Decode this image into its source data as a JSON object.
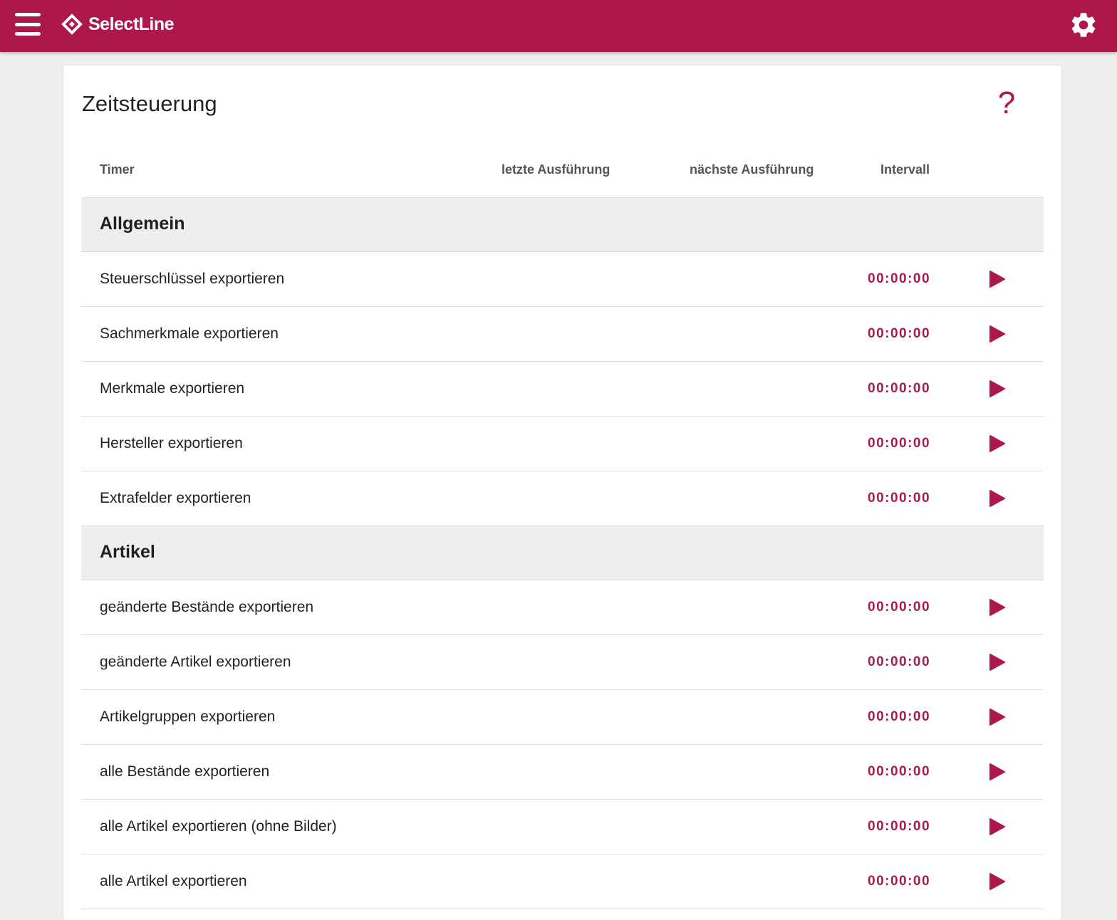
{
  "app": {
    "brand": "SelectLine",
    "accent_color": "#ac1848"
  },
  "header": {
    "menu_icon": "hamburger-menu-icon",
    "settings_icon": "gear-icon"
  },
  "page": {
    "title": "Zeitsteuerung",
    "help_label": "?"
  },
  "table": {
    "columns": {
      "timer": "Timer",
      "last_run": "letzte Ausführung",
      "next_run": "nächste Ausführung",
      "interval": "Intervall"
    },
    "sections": [
      {
        "title": "Allgemein",
        "rows": [
          {
            "name": "Steuerschlüssel exportieren",
            "last_run": "",
            "next_run": "",
            "interval": "00:00:00"
          },
          {
            "name": "Sachmerkmale exportieren",
            "last_run": "",
            "next_run": "",
            "interval": "00:00:00"
          },
          {
            "name": "Merkmale exportieren",
            "last_run": "",
            "next_run": "",
            "interval": "00:00:00"
          },
          {
            "name": "Hersteller exportieren",
            "last_run": "",
            "next_run": "",
            "interval": "00:00:00"
          },
          {
            "name": "Extrafelder exportieren",
            "last_run": "",
            "next_run": "",
            "interval": "00:00:00"
          }
        ]
      },
      {
        "title": "Artikel",
        "rows": [
          {
            "name": "geänderte Bestände exportieren",
            "last_run": "",
            "next_run": "",
            "interval": "00:00:00"
          },
          {
            "name": "geänderte Artikel exportieren",
            "last_run": "",
            "next_run": "",
            "interval": "00:00:00"
          },
          {
            "name": "Artikelgruppen exportieren",
            "last_run": "",
            "next_run": "",
            "interval": "00:00:00"
          },
          {
            "name": "alle Bestände exportieren",
            "last_run": "",
            "next_run": "",
            "interval": "00:00:00"
          },
          {
            "name": "alle Artikel exportieren (ohne Bilder)",
            "last_run": "",
            "next_run": "",
            "interval": "00:00:00"
          },
          {
            "name": "alle Artikel exportieren",
            "last_run": "",
            "next_run": "",
            "interval": "00:00:00"
          }
        ]
      }
    ],
    "row_action_icon": "play-icon"
  }
}
